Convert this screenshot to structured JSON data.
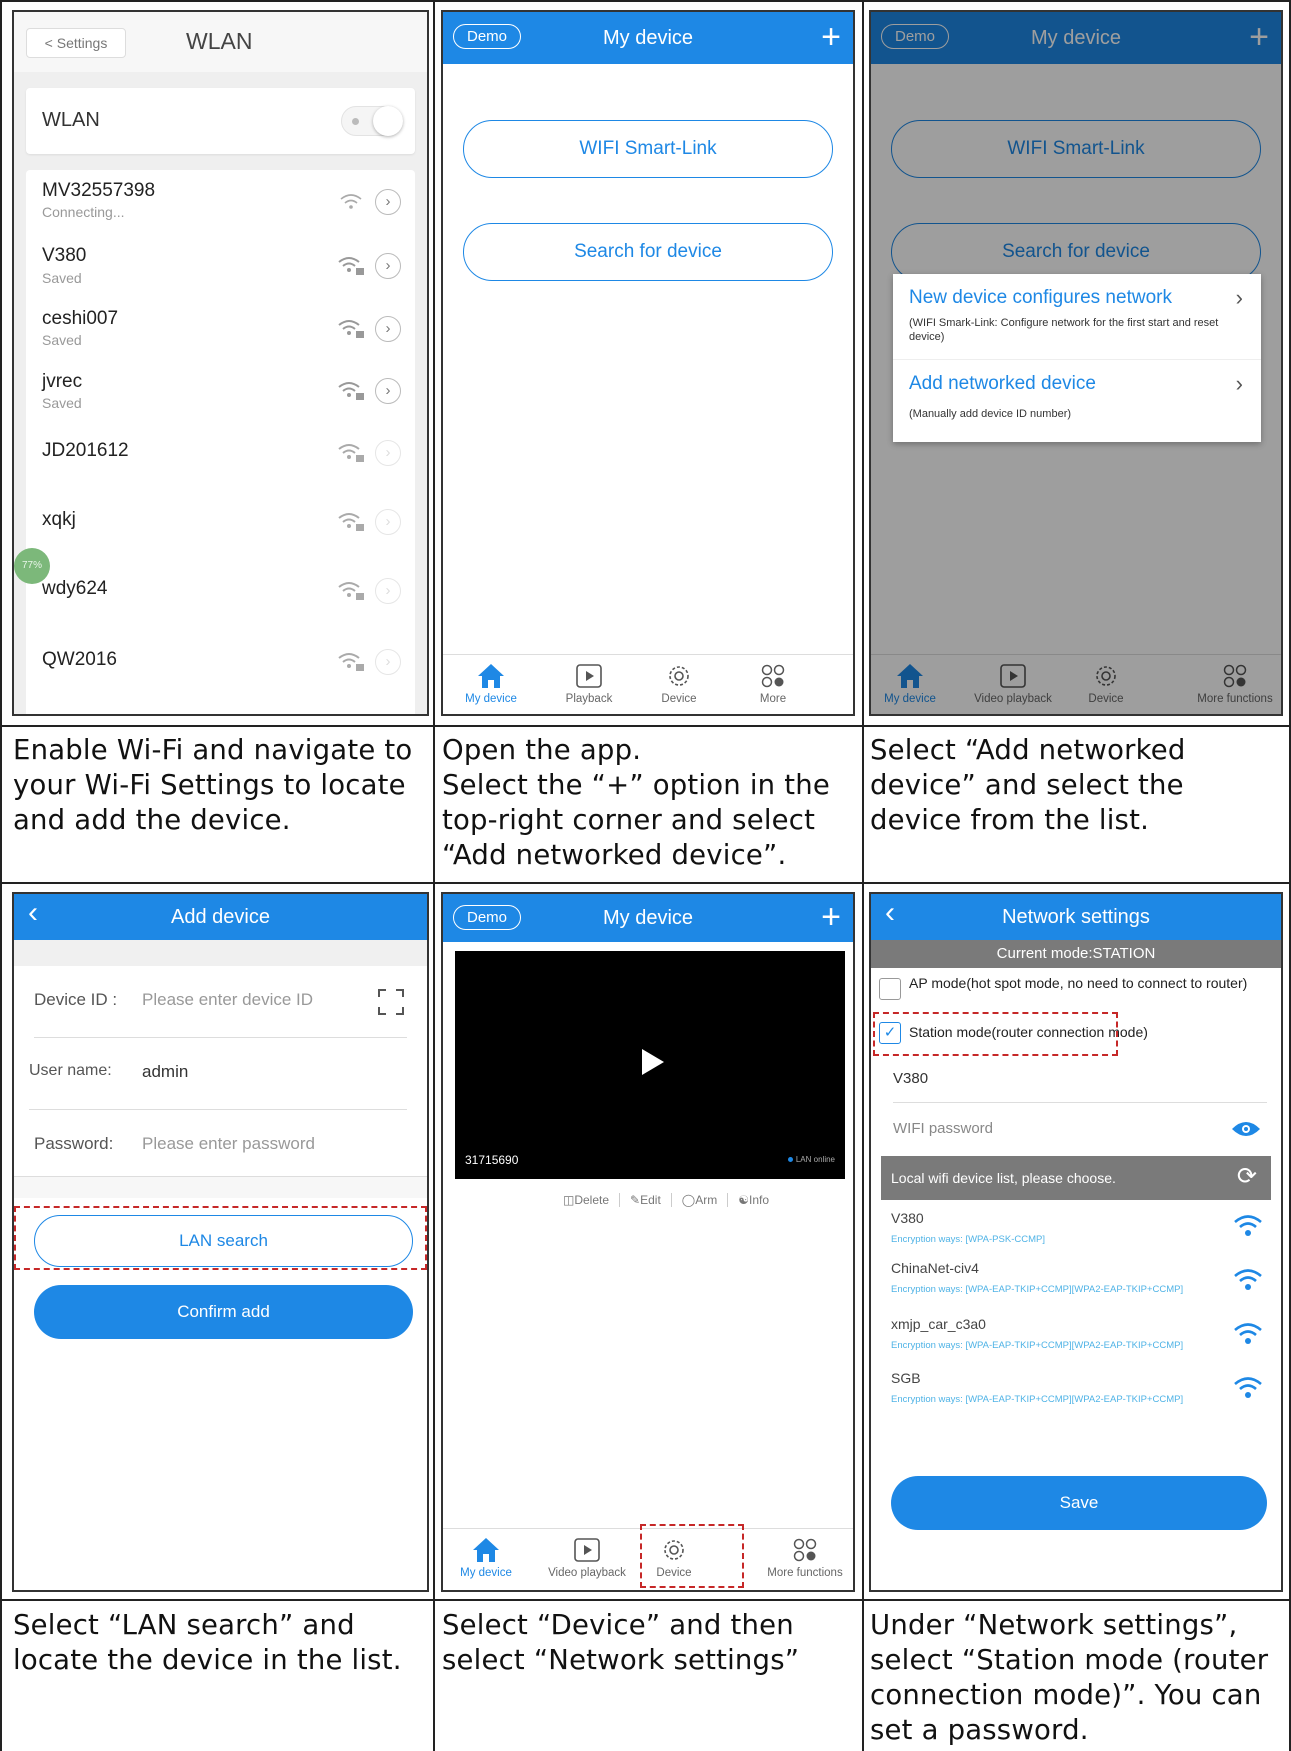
{
  "p1": {
    "back_label": "< Settings",
    "title": "WLAN",
    "toggle_label": "WLAN",
    "networks": [
      {
        "name": "MV32557398",
        "status": "Connecting..."
      },
      {
        "name": "V380",
        "status": "Saved"
      },
      {
        "name": "ceshi007",
        "status": "Saved"
      },
      {
        "name": "jvrec",
        "status": "Saved"
      },
      {
        "name": "JD201612",
        "status": ""
      },
      {
        "name": "xqkj",
        "status": ""
      },
      {
        "name": "wdy624",
        "status": ""
      },
      {
        "name": "QW2016",
        "status": ""
      }
    ],
    "badge": "77%"
  },
  "p2": {
    "demo": "Demo",
    "title": "My device",
    "btn_smartlink": "WIFI Smart-Link",
    "btn_search": "Search for device",
    "tabs": [
      "My device",
      "Playback",
      "Device",
      "More"
    ]
  },
  "p3": {
    "demo": "Demo",
    "title": "My device",
    "btn_smartlink": "WIFI Smart-Link",
    "btn_search": "Search for device",
    "menu_new_title": "New device configures network",
    "menu_new_desc": "(WIFI Smark-Link: Configure network for the first start and reset device)",
    "menu_add_title": "Add networked device",
    "menu_add_desc": "(Manually add device ID number)",
    "tabs": [
      "My device",
      "Video playback",
      "Device",
      "More functions"
    ]
  },
  "p4": {
    "title": "Add device",
    "device_id_label": "Device ID :",
    "device_id_placeholder": "Please enter device ID",
    "username_label": "User name:",
    "username_value": "admin",
    "password_label": "Password:",
    "password_placeholder": "Please enter password",
    "btn_lan": "LAN search",
    "btn_confirm": "Confirm add"
  },
  "p5": {
    "demo": "Demo",
    "title": "My device",
    "device_id": "31715690",
    "status": "LAN online",
    "actions": [
      "Delete",
      "Edit",
      "Arm",
      "Info"
    ],
    "tabs": [
      "My device",
      "Video playback",
      "Device",
      "More functions"
    ]
  },
  "p6": {
    "title": "Network settings",
    "current_mode": "Current mode:STATION",
    "ap_mode": "AP mode(hot spot mode, no need to connect to router)",
    "station_mode": "Station mode(router connection mode)",
    "ssid": "V380",
    "wifi_password": "WIFI password",
    "list_header": "Local wifi device list, please choose.",
    "networks": [
      {
        "name": "V380",
        "enc": "Encryption ways:  [WPA-PSK-CCMP]"
      },
      {
        "name": "ChinaNet-civ4",
        "enc": "Encryption ways:  [WPA-EAP-TKIP+CCMP][WPA2-EAP-TKIP+CCMP]"
      },
      {
        "name": "xmjp_car_c3a0",
        "enc": "Encryption ways:  [WPA-EAP-TKIP+CCMP][WPA2-EAP-TKIP+CCMP]"
      },
      {
        "name": "SGB",
        "enc": "Encryption ways:  [WPA-EAP-TKIP+CCMP][WPA2-EAP-TKIP+CCMP]"
      }
    ],
    "btn_save": "Save"
  },
  "captions": {
    "c1": "Enable Wi-Fi and navigate to your Wi-Fi Settings to locate and add the device.",
    "c2a": "Open the app.",
    "c2b": "Select the “+” option in the top-right corner and select “Add networked device”.",
    "c3": "Select “Add networked device” and select the device from the list.",
    "c4": "Select “LAN search” and locate the device in the list.",
    "c5": "Select “Device” and then select “Network settings”",
    "c6": "Under “Network settings”, select “Station mode (router connection mode)”. You can set a password."
  },
  "colors": {
    "accent": "#1e88e5",
    "highlight": "#c62828"
  }
}
